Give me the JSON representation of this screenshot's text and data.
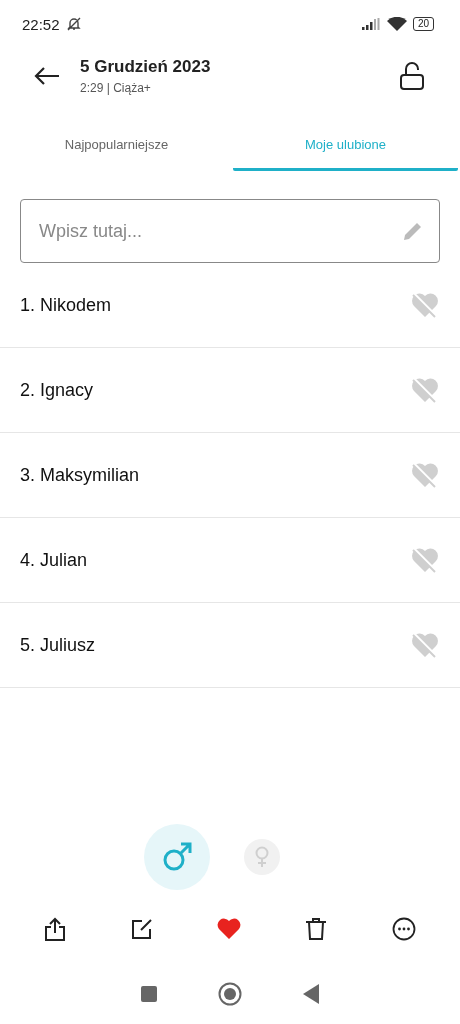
{
  "status_bar": {
    "time": "22:52",
    "battery": "20"
  },
  "header": {
    "title": "5 Grudzień 2023",
    "subtitle": "2:29 | Ciąża+"
  },
  "tabs": [
    {
      "label": "Najpopularniejsze",
      "selected": false
    },
    {
      "label": "Moje ulubione",
      "selected": true
    }
  ],
  "search": {
    "placeholder": "Wpisz tutaj..."
  },
  "names": [
    "1. Nikodem",
    "2. Ignacy",
    "3. Maksymilian",
    "4. Julian",
    "5. Juliusz"
  ],
  "gender": [
    {
      "kind": "male",
      "selected": true
    },
    {
      "kind": "female",
      "selected": false
    }
  ]
}
